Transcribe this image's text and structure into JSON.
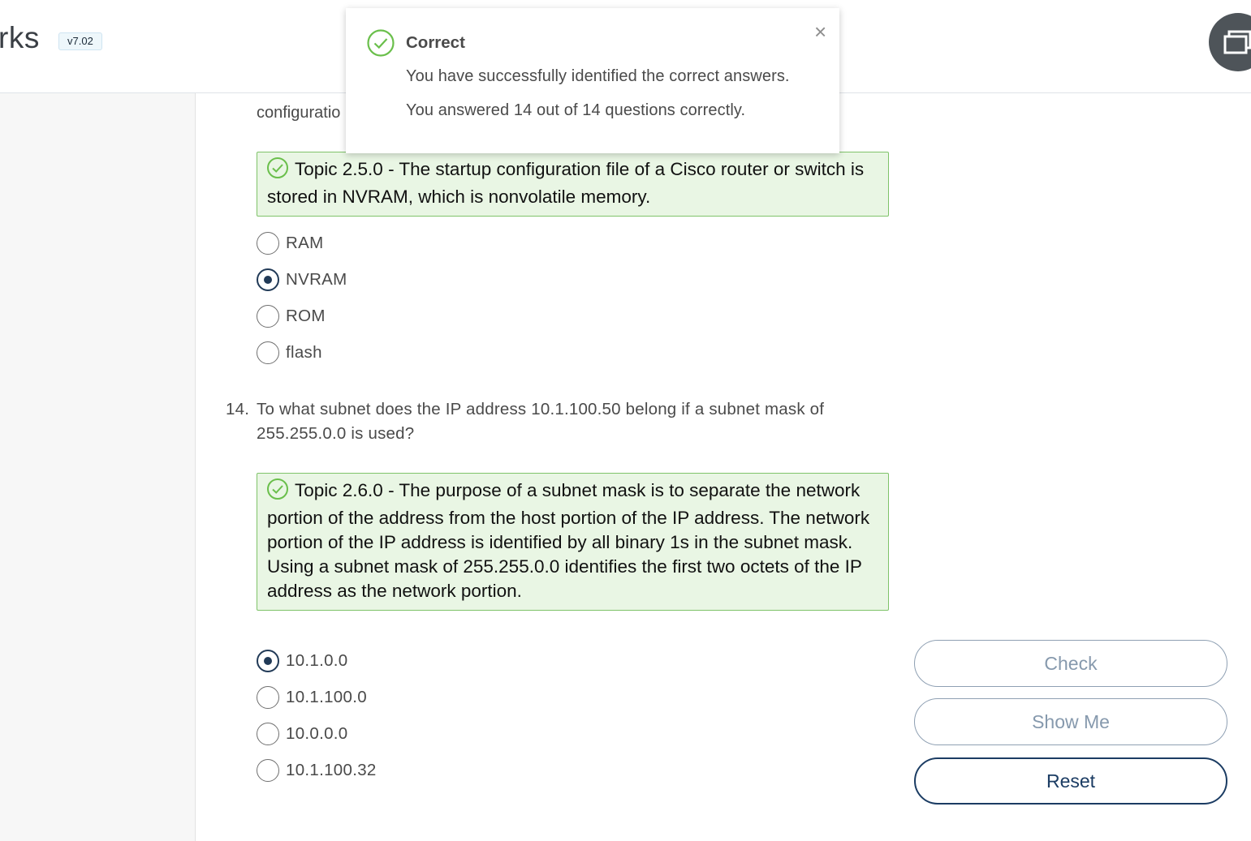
{
  "header": {
    "brand": "rks",
    "version": "v7.02"
  },
  "question13": {
    "continuation": "configuratio",
    "feedback": "Topic 2.5.0 - The startup configuration file of a Cisco router or switch is stored in NVRAM, which is nonvolatile memory.",
    "options": [
      {
        "label": "RAM",
        "selected": false
      },
      {
        "label": "NVRAM",
        "selected": true
      },
      {
        "label": "ROM",
        "selected": false
      },
      {
        "label": "flash",
        "selected": false
      }
    ]
  },
  "question14": {
    "number": "14.",
    "text": "To what subnet does the IP address 10.1.100.50 belong if a subnet mask of 255.255.0.0 is used?",
    "feedback": "Topic 2.6.0 - The purpose of a subnet mask is to separate the network portion of the address from the host portion of the IP address. The network portion of the IP address is identified by all binary 1s in the subnet mask. Using a subnet mask of 255.255.0.0 identifies the first two octets of the IP address as the network portion.",
    "options": [
      {
        "label": "10.1.0.0",
        "selected": true
      },
      {
        "label": "10.1.100.0",
        "selected": false
      },
      {
        "label": "10.0.0.0",
        "selected": false
      },
      {
        "label": "10.1.100.32",
        "selected": false
      }
    ]
  },
  "buttons": {
    "check": "Check",
    "show_me": "Show Me",
    "reset": "Reset"
  },
  "toast": {
    "title": "Correct",
    "line1": "You have successfully identified the correct answers.",
    "line2": "You answered 14 out of 14 questions correctly.",
    "close": "×"
  },
  "colors": {
    "success": "#6abf4b",
    "accent": "#1b3c63",
    "feedback_bg": "#e9f6e4"
  }
}
